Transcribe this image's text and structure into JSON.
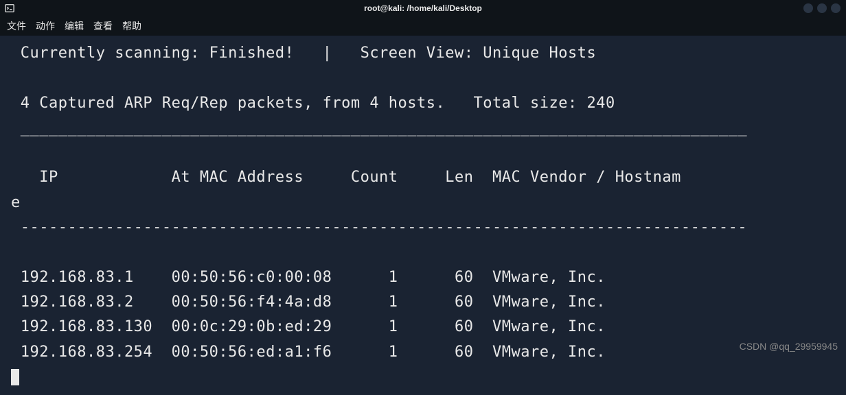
{
  "titlebar": {
    "title": "root@kali: /home/kali/Desktop"
  },
  "menu": {
    "file": "文件",
    "action": "动作",
    "edit": "编辑",
    "view": "查看",
    "help": "帮助"
  },
  "scan": {
    "status_line": " Currently scanning: Finished!   |   Screen View: Unique Hosts",
    "summary_line": " 4 Captured ARP Req/Rep packets, from 4 hosts.   Total size: 240",
    "divider1": " _____________________________________________________________________________",
    "header_line1": "   IP            At MAC Address     Count     Len  MAC Vendor / Hostnam",
    "header_line2": "e",
    "divider2": " -----------------------------------------------------------------------------",
    "rows": [
      " 192.168.83.1    00:50:56:c0:00:08      1      60  VMware, Inc.",
      " 192.168.83.2    00:50:56:f4:4a:d8      1      60  VMware, Inc.",
      " 192.168.83.130  00:0c:29:0b:ed:29      1      60  VMware, Inc.",
      " 192.168.83.254  00:50:56:ed:a1:f6      1      60  VMware, Inc."
    ]
  },
  "watermark": "CSDN @qq_29959945"
}
